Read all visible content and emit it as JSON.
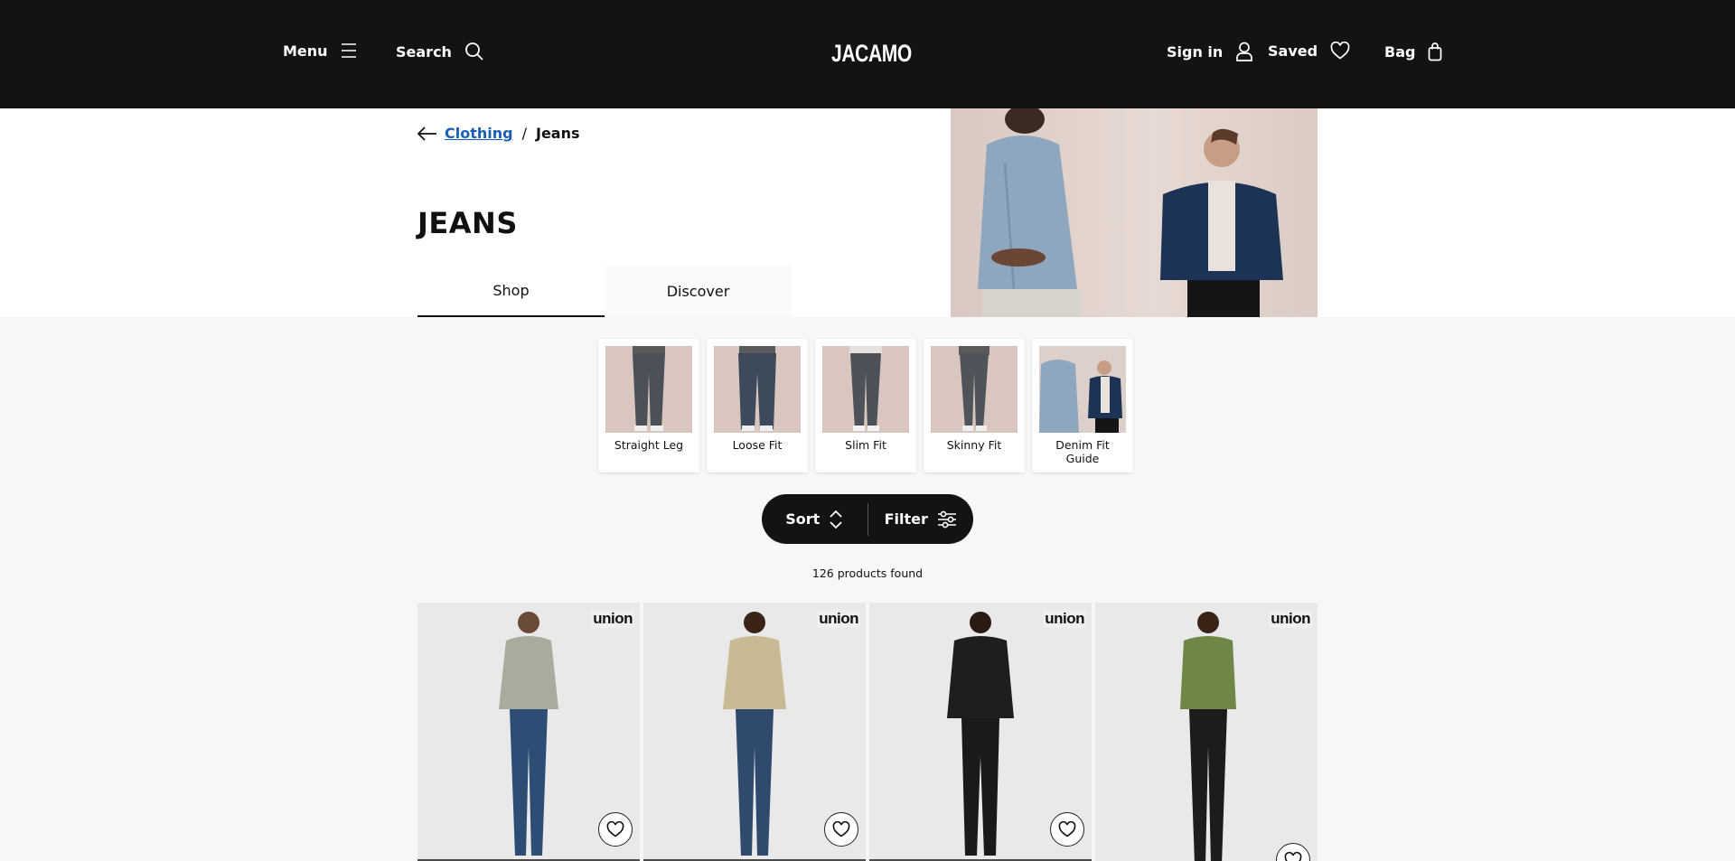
{
  "header": {
    "menu_label": "Menu",
    "search_label": "Search",
    "logo": "JACAMO",
    "signin_label": "Sign in",
    "saved_label": "Saved",
    "bag_label": "Bag"
  },
  "breadcrumb": {
    "parent": "Clothing",
    "separator": "/",
    "current": "Jeans"
  },
  "page": {
    "title": "JEANS",
    "tabs": [
      {
        "label": "Shop",
        "active": true
      },
      {
        "label": "Discover",
        "active": false
      }
    ]
  },
  "categories": [
    {
      "label": "Straight Leg"
    },
    {
      "label": "Loose Fit"
    },
    {
      "label": "Slim Fit"
    },
    {
      "label": "Skinny Fit"
    },
    {
      "label": "Denim Fit Guide"
    }
  ],
  "toolbar": {
    "sort_label": "Sort",
    "filter_label": "Filter"
  },
  "results": {
    "count_text": "126 products found"
  },
  "products": [
    {
      "brand": "union",
      "top_color": "#a9ab9c",
      "pants_color": "#2e4d74"
    },
    {
      "brand": "union",
      "top_color": "#c8bb93",
      "pants_color": "#2f4a6d"
    },
    {
      "brand": "union",
      "top_color": "#1e1e1e",
      "pants_color": "#1a1a1a"
    },
    {
      "brand": "union",
      "top_color": "#6e8747",
      "pants_color": "#1c1c1c"
    }
  ],
  "colors": {
    "header_bg": "#131313",
    "link": "#1a5fb4",
    "page_bg": "#f7f7f7"
  }
}
